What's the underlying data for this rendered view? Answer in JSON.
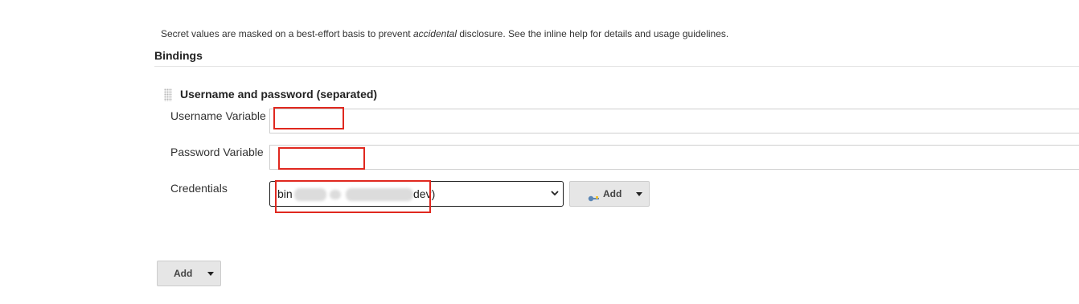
{
  "notice": {
    "before": "Secret values are masked on a best-effort basis to prevent ",
    "emphasis": "accidental",
    "after": " disclosure. See the inline help for details and usage guidelines."
  },
  "bindings": {
    "title": "Bindings",
    "binding_type": "Username and password (separated)",
    "username": {
      "label": "Username Variable",
      "value": ""
    },
    "password": {
      "label": "Password Variable",
      "value": ""
    },
    "credentials": {
      "label": "Credentials",
      "selected_start": "bin",
      "selected_end": "dev)",
      "add_label": "Add"
    }
  },
  "footer": {
    "add_label": "Add"
  },
  "colors": {
    "annotation": "#e0281f",
    "button_bg": "#e6e6e6",
    "divider": "#e4e4e4"
  },
  "icons": {
    "drag_handle": "drag-handle-icon",
    "key": "key-icon",
    "dropdown": "chevron-down-icon"
  }
}
